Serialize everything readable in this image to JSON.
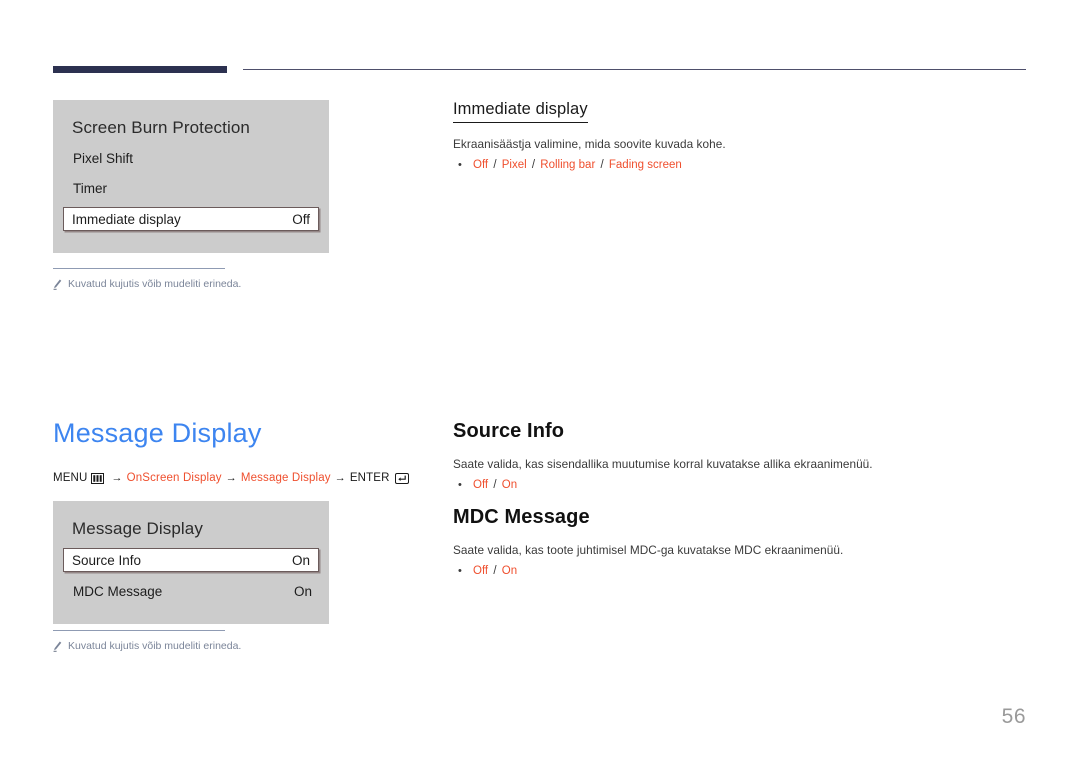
{
  "page": {
    "number": "56"
  },
  "footnote": {
    "text": "Kuvatud kujutis võib mudeliti erineda."
  },
  "section_top": {
    "osd": {
      "title": "Screen Burn Protection",
      "rows": [
        {
          "label": "Pixel Shift",
          "value": "",
          "selected": false
        },
        {
          "label": "Timer",
          "value": "",
          "selected": false
        },
        {
          "label": "Immediate display",
          "value": "Off",
          "selected": true
        }
      ]
    },
    "article": {
      "heading": "Immediate display",
      "description": "Ekraanisäästja valimine, mida soovite kuvada kohe.",
      "options": [
        "Off",
        "Pixel",
        "Rolling bar",
        "Fading screen"
      ],
      "separator": "/",
      "bullet": "•"
    }
  },
  "section_message_display": {
    "heading": "Message Display",
    "menu_path": {
      "menu_label": "MENU",
      "menu_icon": "menu-grid-icon",
      "arrow": "→",
      "step1": "OnScreen Display",
      "step2": "Message Display",
      "enter_label": "ENTER",
      "enter_icon": "enter-key-icon"
    },
    "osd": {
      "title": "Message Display",
      "rows": [
        {
          "label": "Source Info",
          "value": "On",
          "selected": true
        },
        {
          "label": "MDC Message",
          "value": "On",
          "selected": false
        }
      ]
    },
    "articles": [
      {
        "heading": "Source Info",
        "description": "Saate valida, kas sisendallika muutumise korral kuvatakse allika ekraanimenüü.",
        "options": [
          "Off",
          "On"
        ],
        "separator": "/",
        "bullet": "•"
      },
      {
        "heading": "MDC Message",
        "description": "Saate valida, kas toote juhtimisel MDC-ga kuvatakse MDC ekraanimenüü.",
        "options": [
          "Off",
          "On"
        ],
        "separator": "/",
        "bullet": "•"
      }
    ]
  },
  "colors": {
    "accent_blue": "#3d85f0",
    "accent_orange": "#ef4f2e",
    "header_navy": "#2c3150",
    "osd_gray": "#cccccc",
    "footnote_gray": "#7b8599"
  }
}
